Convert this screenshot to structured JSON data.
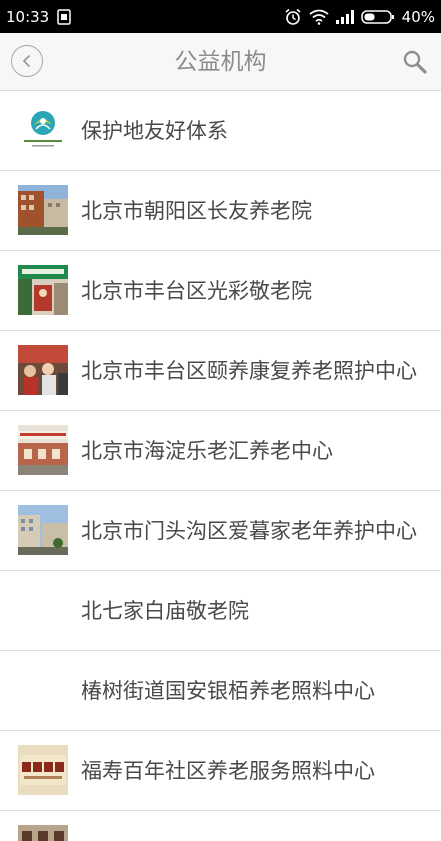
{
  "status_bar": {
    "time": "10:33",
    "battery_percent": "40%"
  },
  "nav": {
    "title": "公益机构"
  },
  "list": {
    "items": [
      {
        "label": "保护地友好体系",
        "thumb": "logo"
      },
      {
        "label": "北京市朝阳区长友养老院",
        "thumb": "photo-building"
      },
      {
        "label": "北京市丰台区光彩敬老院",
        "thumb": "photo-green"
      },
      {
        "label": "北京市丰台区颐养康复养老照护中心",
        "thumb": "photo-red"
      },
      {
        "label": "北京市海淀乐老汇养老中心",
        "thumb": "photo-house"
      },
      {
        "label": "北京市门头沟区爱暮家老年养护中心",
        "thumb": "photo-sky"
      },
      {
        "label": "北七家白庙敬老院",
        "thumb": "none"
      },
      {
        "label": "椿树街道国安银栢养老照料中心",
        "thumb": "none"
      },
      {
        "label": "福寿百年社区养老服务照料中心",
        "thumb": "sign"
      }
    ]
  }
}
